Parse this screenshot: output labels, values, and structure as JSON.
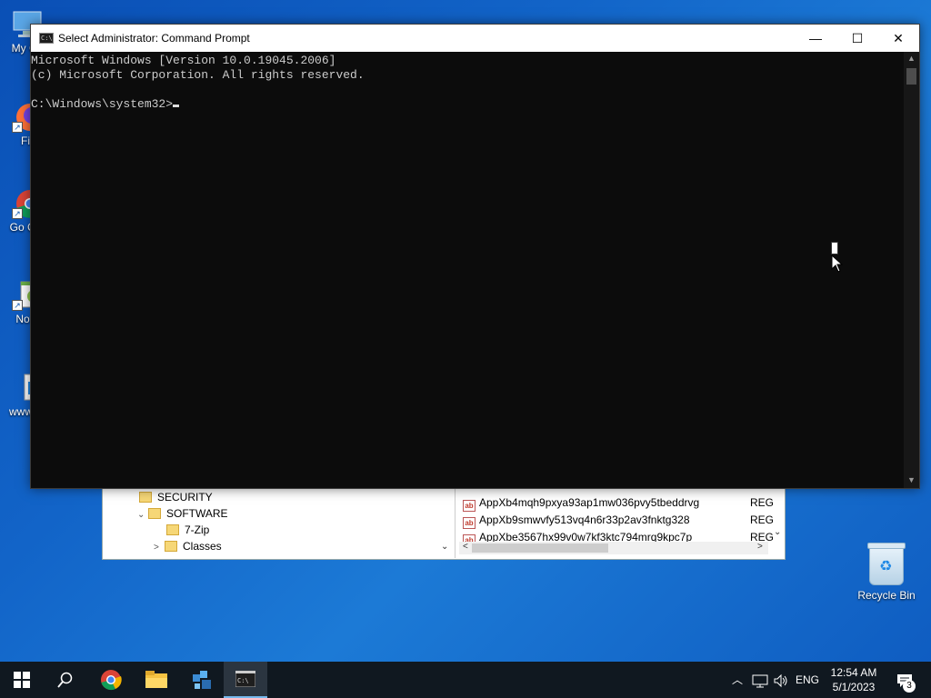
{
  "desktop": {
    "icons": [
      {
        "label": "My Co",
        "icon": "computer-icon"
      },
      {
        "label": "Fir",
        "icon": "firefox-icon"
      },
      {
        "label": "Go Chr",
        "icon": "chrome-icon"
      },
      {
        "label": "Note",
        "icon": "notepad-icon"
      },
      {
        "label": "www",
        "icon": "web-file-icon"
      }
    ],
    "recycle_bin": "Recycle Bin"
  },
  "regedit": {
    "tree": [
      {
        "label": "SECURITY",
        "expander": ""
      },
      {
        "label": "SOFTWARE",
        "expander": "⌄"
      },
      {
        "label": "7-Zip",
        "expander": ""
      },
      {
        "label": "Classes",
        "expander": ">"
      }
    ],
    "values": [
      {
        "name": "AppXb4mqh9pxya93ap1mw036pvy5tbeddrvg",
        "type": "REG"
      },
      {
        "name": "AppXb9smwvfy513vq4n6r33p2av3fnktg328",
        "type": "REG"
      },
      {
        "name": "AppXbe3567hx99v0w7kf3ktc794mrq9kpc7p",
        "type": "REG"
      }
    ]
  },
  "cmd": {
    "title": "Select Administrator:  Command Prompt",
    "lines": [
      "Microsoft Windows [Version 10.0.19045.2006]",
      "(c) Microsoft Corporation. All rights reserved.",
      "C:\\Windows\\system32>"
    ],
    "minimize": "—",
    "maximize": "☐",
    "close": "✕"
  },
  "taskbar": {
    "language": "ENG",
    "time": "12:54 AM",
    "date": "5/1/2023",
    "notification_count": "3"
  }
}
